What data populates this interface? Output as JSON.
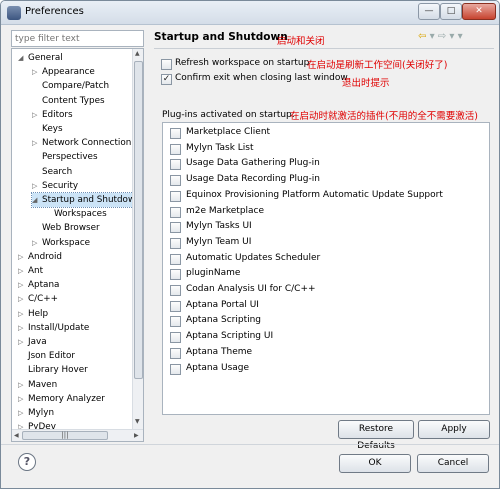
{
  "window": {
    "title": "Preferences",
    "min_glyph": "—",
    "max_glyph": "□",
    "close_glyph": "✕"
  },
  "filter": {
    "placeholder": "type filter text"
  },
  "tree": {
    "items": [
      {
        "label": "General",
        "arrow": "◢",
        "indent": 0
      },
      {
        "label": "Appearance",
        "arrow": "▷",
        "indent": 1
      },
      {
        "label": "Compare/Patch",
        "arrow": "",
        "indent": 1
      },
      {
        "label": "Content Types",
        "arrow": "",
        "indent": 1
      },
      {
        "label": "Editors",
        "arrow": "▷",
        "indent": 1
      },
      {
        "label": "Keys",
        "arrow": "",
        "indent": 1
      },
      {
        "label": "Network Connection",
        "arrow": "▷",
        "indent": 1
      },
      {
        "label": "Perspectives",
        "arrow": "",
        "indent": 1
      },
      {
        "label": "Search",
        "arrow": "",
        "indent": 1
      },
      {
        "label": "Security",
        "arrow": "▷",
        "indent": 1
      },
      {
        "label": "Startup and Shutdown",
        "arrow": "◢",
        "indent": 1,
        "selected": true
      },
      {
        "label": "Workspaces",
        "arrow": "",
        "indent": 2
      },
      {
        "label": "Web Browser",
        "arrow": "",
        "indent": 1
      },
      {
        "label": "Workspace",
        "arrow": "▷",
        "indent": 1
      },
      {
        "label": "Android",
        "arrow": "▷",
        "indent": 0
      },
      {
        "label": "Ant",
        "arrow": "▷",
        "indent": 0
      },
      {
        "label": "Aptana",
        "arrow": "▷",
        "indent": 0
      },
      {
        "label": "C/C++",
        "arrow": "▷",
        "indent": 0
      },
      {
        "label": "Help",
        "arrow": "▷",
        "indent": 0
      },
      {
        "label": "Install/Update",
        "arrow": "▷",
        "indent": 0
      },
      {
        "label": "Java",
        "arrow": "▷",
        "indent": 0
      },
      {
        "label": "Json Editor",
        "arrow": "",
        "indent": 0
      },
      {
        "label": "Library Hover",
        "arrow": "",
        "indent": 0
      },
      {
        "label": "Maven",
        "arrow": "▷",
        "indent": 0
      },
      {
        "label": "Memory Analyzer",
        "arrow": "▷",
        "indent": 0
      },
      {
        "label": "Mylyn",
        "arrow": "▷",
        "indent": 0
      },
      {
        "label": "PyDev",
        "arrow": "▷",
        "indent": 0
      }
    ],
    "hscroll_grip": "|||"
  },
  "panel": {
    "title": "Startup and Shutdown",
    "title_note": "启动和关闭",
    "refresh_label": "Refresh workspace on startup",
    "refresh_checked": false,
    "refresh_note": "在启动是刷新工作空间(关闭好了)",
    "confirm_label": "Confirm exit when closing last window",
    "confirm_checked": true,
    "confirm_note": "退出时提示",
    "plugins_label": "Plug-ins activated on startup:",
    "plugins_note": "在启动时就激活的插件(不用的全不需要激活)",
    "plugins": [
      "Marketplace Client",
      "Mylyn Task List",
      "Usage Data Gathering Plug-in",
      "Usage Data Recording Plug-in",
      "Equinox Provisioning Platform Automatic Update Support",
      "m2e Marketplace",
      "Mylyn Tasks UI",
      "Mylyn Team UI",
      "Automatic Updates Scheduler",
      "pluginName",
      "Codan Analysis UI for C/C++",
      "Aptana Portal UI",
      "Aptana Scripting",
      "Aptana Scripting UI",
      "Aptana Theme",
      "Aptana Usage"
    ]
  },
  "buttons": {
    "restore": "Restore Defaults",
    "apply": "Apply",
    "ok": "OK",
    "cancel": "Cancel",
    "help": "?"
  },
  "colors": {
    "annotation": "#e00000",
    "selection": "#cce4f7"
  }
}
